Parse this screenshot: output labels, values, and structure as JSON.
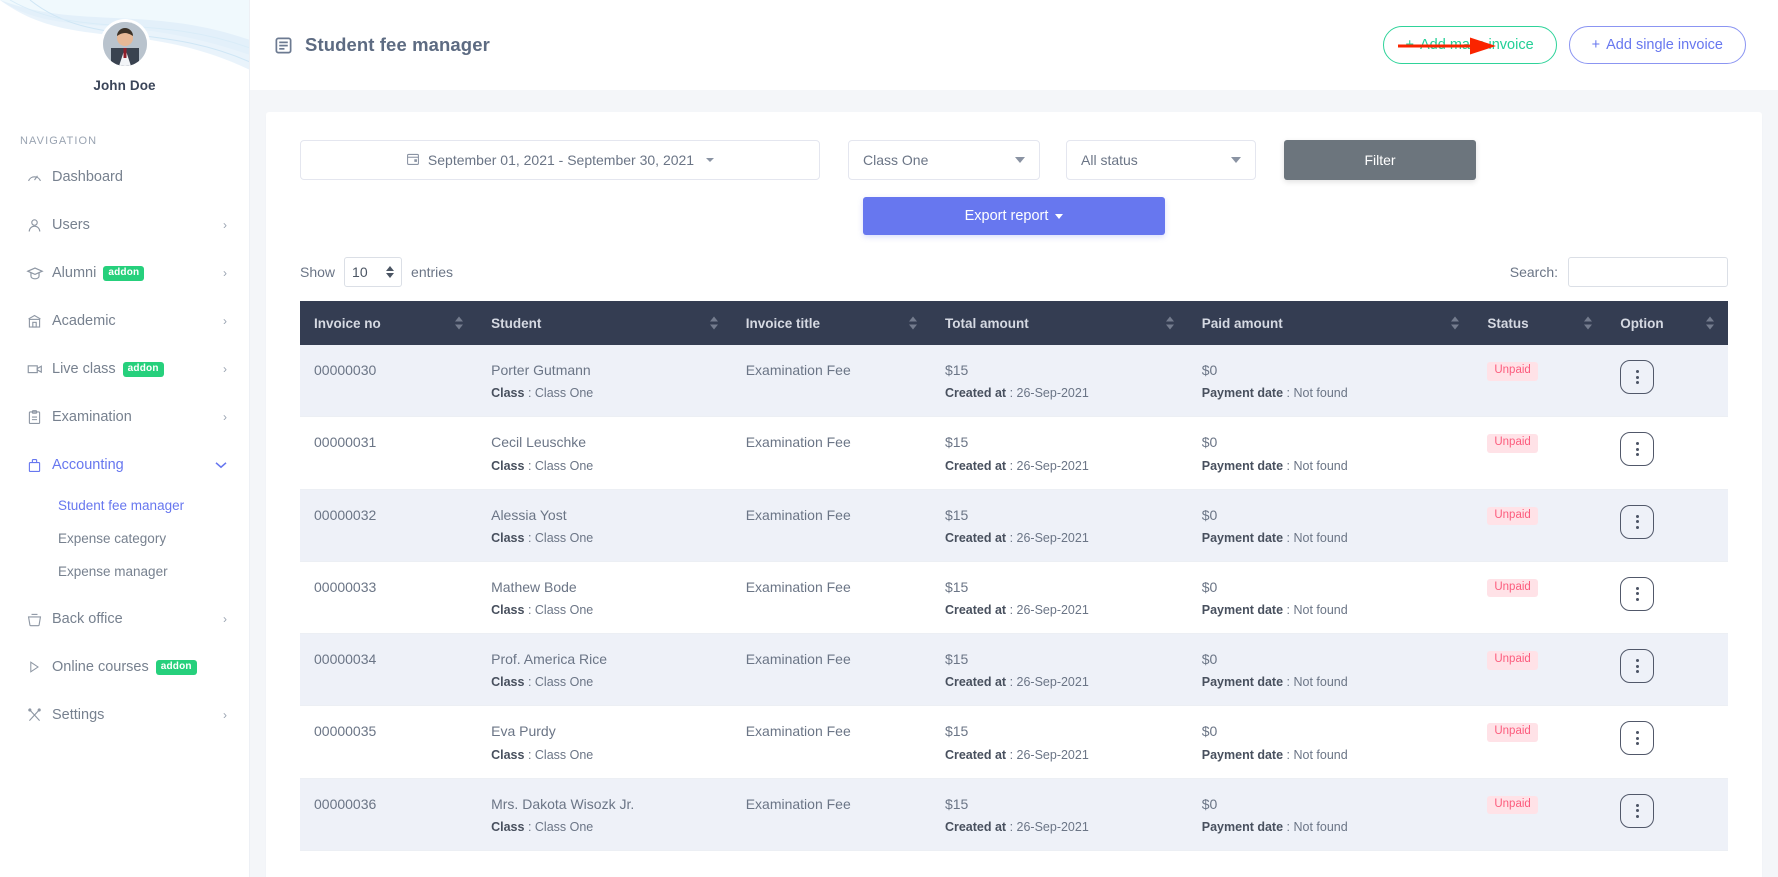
{
  "sidebar": {
    "profile": {
      "name": "John Doe",
      "avatar_icon": "user-avatar-photo"
    },
    "section_label": "NAVIGATION",
    "items": [
      {
        "label": "Dashboard",
        "icon": "speedometer-icon",
        "chevron": "",
        "addon": ""
      },
      {
        "label": "Users",
        "icon": "person-icon",
        "chevron": "›",
        "addon": ""
      },
      {
        "label": "Alumni",
        "icon": "graduation-cap-icon",
        "chevron": "›",
        "addon": "addon"
      },
      {
        "label": "Academic",
        "icon": "bank-icon",
        "chevron": "›",
        "addon": ""
      },
      {
        "label": "Live class",
        "icon": "video-camera-icon",
        "chevron": "›",
        "addon": "addon"
      },
      {
        "label": "Examination",
        "icon": "clipboard-icon",
        "chevron": "›",
        "addon": ""
      },
      {
        "label": "Accounting",
        "icon": "briefcase-icon",
        "chevron": "⌄",
        "addon": ""
      }
    ],
    "sub_items": [
      {
        "label": "Student fee manager",
        "active": true
      },
      {
        "label": "Expense category",
        "active": false
      },
      {
        "label": "Expense manager",
        "active": false
      }
    ],
    "items_after": [
      {
        "label": "Back office",
        "icon": "basket-icon",
        "chevron": "›",
        "addon": ""
      },
      {
        "label": "Online courses",
        "icon": "play-triangle-icon",
        "chevron": "",
        "addon": "addon"
      },
      {
        "label": "Settings",
        "icon": "tools-icon",
        "chevron": "›",
        "addon": ""
      }
    ],
    "addon_badge_color": "#26d07c",
    "active_color": "#6777ef"
  },
  "header": {
    "title": "Student fee manager",
    "title_icon": "document-list-icon",
    "add_mass_invoice": "+ Add mass invoice",
    "add_mass_invoice_plus": "+",
    "add_mass_invoice_label": "Add mass invoice",
    "add_single_invoice_plus": "+",
    "add_single_invoice_label": "Add single invoice",
    "mass_invoice_color": "#23cf96",
    "single_invoice_color": "#6777ef",
    "annotation_arrow_color": "#fa2400"
  },
  "filters": {
    "date_range": "September 01, 2021 - September 30, 2021",
    "date_range_icon": "calendar-icon",
    "class_select": "Class One",
    "status_select": "All status",
    "filter_button": "Filter",
    "export_button": "Export report"
  },
  "table_controls": {
    "show_label": "Show",
    "entries_value": "10",
    "entries_label": "entries",
    "search_label": "Search:",
    "search_value": "",
    "search_placeholder": ""
  },
  "table": {
    "columns": [
      "Invoice no",
      "Student",
      "Invoice title",
      "Total amount",
      "Paid amount",
      "Status",
      "Option"
    ],
    "labels": {
      "class_prefix": "Class",
      "created_prefix": "Created at",
      "payment_prefix": "Payment date"
    },
    "rows": [
      {
        "invoice_no": "00000030",
        "student": "Porter Gutmann",
        "class": "Class One",
        "invoice_title": "Examination Fee",
        "total_amount": "$15",
        "created_at": "26-Sep-2021",
        "paid_amount": "$0",
        "payment_date": "Not found",
        "status": "Unpaid",
        "option_icon": "kebab-menu-icon"
      },
      {
        "invoice_no": "00000031",
        "student": "Cecil Leuschke",
        "class": "Class One",
        "invoice_title": "Examination Fee",
        "total_amount": "$15",
        "created_at": "26-Sep-2021",
        "paid_amount": "$0",
        "payment_date": "Not found",
        "status": "Unpaid",
        "option_icon": "kebab-menu-icon"
      },
      {
        "invoice_no": "00000032",
        "student": "Alessia Yost",
        "class": "Class One",
        "invoice_title": "Examination Fee",
        "total_amount": "$15",
        "created_at": "26-Sep-2021",
        "paid_amount": "$0",
        "payment_date": "Not found",
        "status": "Unpaid",
        "option_icon": "kebab-menu-icon"
      },
      {
        "invoice_no": "00000033",
        "student": "Mathew Bode",
        "class": "Class One",
        "invoice_title": "Examination Fee",
        "total_amount": "$15",
        "created_at": "26-Sep-2021",
        "paid_amount": "$0",
        "payment_date": "Not found",
        "status": "Unpaid",
        "option_icon": "kebab-menu-icon"
      },
      {
        "invoice_no": "00000034",
        "student": "Prof. America Rice",
        "class": "Class One",
        "invoice_title": "Examination Fee",
        "total_amount": "$15",
        "created_at": "26-Sep-2021",
        "paid_amount": "$0",
        "payment_date": "Not found",
        "status": "Unpaid",
        "option_icon": "kebab-menu-icon"
      },
      {
        "invoice_no": "00000035",
        "student": "Eva Purdy",
        "class": "Class One",
        "invoice_title": "Examination Fee",
        "total_amount": "$15",
        "created_at": "26-Sep-2021",
        "paid_amount": "$0",
        "payment_date": "Not found",
        "status": "Unpaid",
        "option_icon": "kebab-menu-icon"
      },
      {
        "invoice_no": "00000036",
        "student": "Mrs. Dakota Wisozk Jr.",
        "class": "Class One",
        "invoice_title": "Examination Fee",
        "total_amount": "$15",
        "created_at": "26-Sep-2021",
        "paid_amount": "$0",
        "payment_date": "Not found",
        "status": "Unpaid",
        "option_icon": "kebab-menu-icon"
      }
    ],
    "status_color": "#fc5c7d",
    "header_bg": "#343d52"
  }
}
